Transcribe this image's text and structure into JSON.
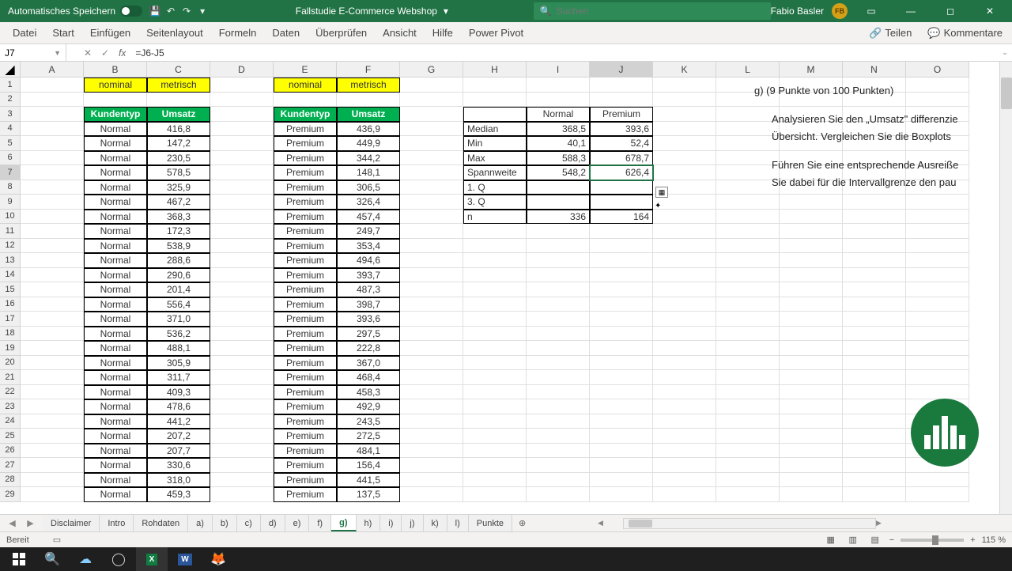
{
  "titlebar": {
    "autosave": "Automatisches Speichern",
    "filename": "Fallstudie E-Commerce Webshop",
    "search_placeholder": "Suchen",
    "username": "Fabio Basler",
    "user_initials": "FB"
  },
  "ribbon": {
    "tabs": [
      "Datei",
      "Start",
      "Einfügen",
      "Seitenlayout",
      "Formeln",
      "Daten",
      "Überprüfen",
      "Ansicht",
      "Hilfe",
      "Power Pivot"
    ],
    "share": "Teilen",
    "comments": "Kommentare"
  },
  "formula_bar": {
    "cell_ref": "J7",
    "formula": "=J6-J5"
  },
  "columns": [
    "A",
    "B",
    "C",
    "D",
    "E",
    "F",
    "G",
    "H",
    "I",
    "J",
    "K",
    "L",
    "M",
    "N",
    "O"
  ],
  "row_count": 29,
  "selected_cell": {
    "row": 7,
    "col": "J"
  },
  "table1_header1": {
    "B": "nominal",
    "C": "metrisch"
  },
  "table1_header2": {
    "B": "Kundentyp",
    "C": "Umsatz"
  },
  "table1_rows": [
    [
      "Normal",
      "416,8"
    ],
    [
      "Normal",
      "147,2"
    ],
    [
      "Normal",
      "230,5"
    ],
    [
      "Normal",
      "578,5"
    ],
    [
      "Normal",
      "325,9"
    ],
    [
      "Normal",
      "467,2"
    ],
    [
      "Normal",
      "368,3"
    ],
    [
      "Normal",
      "172,3"
    ],
    [
      "Normal",
      "538,9"
    ],
    [
      "Normal",
      "288,6"
    ],
    [
      "Normal",
      "290,6"
    ],
    [
      "Normal",
      "201,4"
    ],
    [
      "Normal",
      "556,4"
    ],
    [
      "Normal",
      "371,0"
    ],
    [
      "Normal",
      "536,2"
    ],
    [
      "Normal",
      "488,1"
    ],
    [
      "Normal",
      "305,9"
    ],
    [
      "Normal",
      "311,7"
    ],
    [
      "Normal",
      "409,3"
    ],
    [
      "Normal",
      "478,6"
    ],
    [
      "Normal",
      "441,2"
    ],
    [
      "Normal",
      "207,2"
    ],
    [
      "Normal",
      "207,7"
    ],
    [
      "Normal",
      "330,6"
    ],
    [
      "Normal",
      "318,0"
    ],
    [
      "Normal",
      "459,3"
    ]
  ],
  "table2_header1": {
    "E": "nominal",
    "F": "metrisch"
  },
  "table2_header2": {
    "E": "Kundentyp",
    "F": "Umsatz"
  },
  "table2_rows": [
    [
      "Premium",
      "436,9"
    ],
    [
      "Premium",
      "449,9"
    ],
    [
      "Premium",
      "344,2"
    ],
    [
      "Premium",
      "148,1"
    ],
    [
      "Premium",
      "306,5"
    ],
    [
      "Premium",
      "326,4"
    ],
    [
      "Premium",
      "457,4"
    ],
    [
      "Premium",
      "249,7"
    ],
    [
      "Premium",
      "353,4"
    ],
    [
      "Premium",
      "494,6"
    ],
    [
      "Premium",
      "393,7"
    ],
    [
      "Premium",
      "487,3"
    ],
    [
      "Premium",
      "398,7"
    ],
    [
      "Premium",
      "393,6"
    ],
    [
      "Premium",
      "297,5"
    ],
    [
      "Premium",
      "222,8"
    ],
    [
      "Premium",
      "367,0"
    ],
    [
      "Premium",
      "468,4"
    ],
    [
      "Premium",
      "458,3"
    ],
    [
      "Premium",
      "492,9"
    ],
    [
      "Premium",
      "243,5"
    ],
    [
      "Premium",
      "272,5"
    ],
    [
      "Premium",
      "484,1"
    ],
    [
      "Premium",
      "156,4"
    ],
    [
      "Premium",
      "441,5"
    ],
    [
      "Premium",
      "137,5"
    ]
  ],
  "stats_table": {
    "col_headers": [
      "Normal",
      "Premium"
    ],
    "rows": [
      {
        "label": "Median",
        "normal": "368,5",
        "premium": "393,6"
      },
      {
        "label": "Min",
        "normal": "40,1",
        "premium": "52,4"
      },
      {
        "label": "Max",
        "normal": "588,3",
        "premium": "678,7"
      },
      {
        "label": "Spannweite",
        "normal": "548,2",
        "premium": "626,4"
      },
      {
        "label": "1. Q",
        "normal": "",
        "premium": ""
      },
      {
        "label": "3. Q",
        "normal": "",
        "premium": ""
      },
      {
        "label": "n",
        "normal": "336",
        "premium": "164"
      }
    ]
  },
  "task": {
    "title": "g) (9 Punkte von 100 Punkten)",
    "line1": "Analysieren Sie den „Umsatz\" differenzie",
    "line2": "Übersicht. Vergleichen Sie die Boxplots",
    "line3": "Führen Sie eine entsprechende Ausreiße",
    "line4": "Sie dabei für die Intervallgrenze den pau"
  },
  "sheet_tabs": [
    "Disclaimer",
    "Intro",
    "Rohdaten",
    "a)",
    "b)",
    "c)",
    "d)",
    "e)",
    "f)",
    "g)",
    "h)",
    "i)",
    "j)",
    "k)",
    "l)",
    "Punkte"
  ],
  "active_sheet": "g)",
  "status": {
    "ready": "Bereit",
    "zoom": "115 %"
  }
}
